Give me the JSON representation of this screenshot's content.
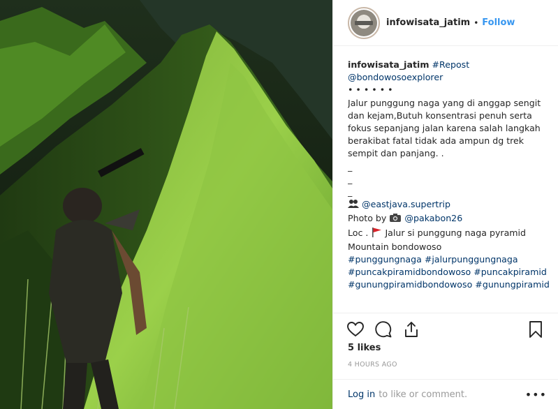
{
  "header": {
    "username": "infowisata_jatim",
    "separator": "•",
    "follow_label": "Follow"
  },
  "caption": {
    "author": "infowisata_jatim",
    "tag_repost": "#Repost",
    "mention_source": "@bondowosoexplorer",
    "bullets": "• • • • • •",
    "body_lines": [
      "Jalur punggung naga yang di anggap sengit",
      "dan kejam,Butuh konsentrasi penuh serta",
      "fokus sepanjang jalan karena salah langkah",
      "berakibat fatal tidak ada ampun dg trek",
      "sempit dan panjang. ."
    ],
    "dash": "_",
    "mention_supertrip": "@eastjava.supertrip",
    "photo_by_label": "Photo by",
    "mention_photographer": "@pakabon26",
    "loc_label": "Loc .",
    "location_line1": "Jalur si punggung naga pyramid",
    "location_line2": "Mountain bondowoso",
    "hashtags_line1": "#punggungnaga #jalurpunggungnaga",
    "hashtags_line2": "#puncakpiramidbondowoso #puncakpiramid",
    "hashtags_line3": "#gunungpiramidbondowoso #gunungpiramid"
  },
  "icons": [
    "heart-icon",
    "comment-icon",
    "share-icon",
    "bookmark-icon",
    "camera-icon",
    "red-flag-icon",
    "people-icon"
  ],
  "stats": {
    "likes": "5 likes",
    "timestamp": "4 HOURS AGO"
  },
  "comment_bar": {
    "login_label": "Log in",
    "rest_label": "to like or comment.",
    "more_label": "•••"
  },
  "colors": {
    "link": "#003569",
    "follow": "#3897f0",
    "muted": "#999999"
  }
}
